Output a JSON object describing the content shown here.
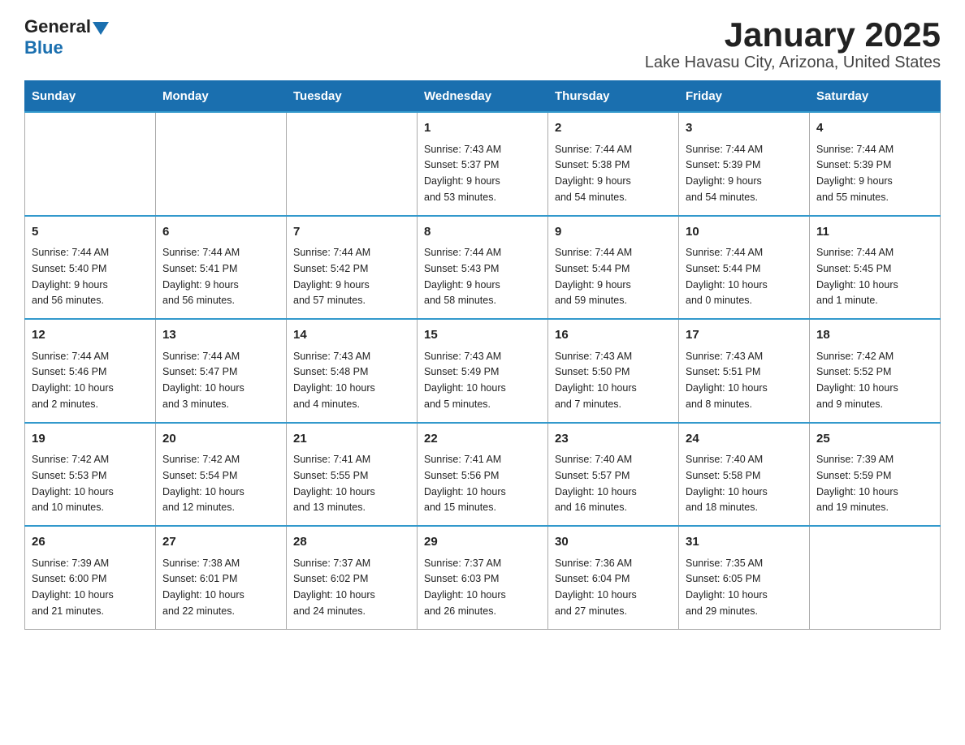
{
  "header": {
    "logo": {
      "general": "General",
      "blue": "Blue"
    },
    "title": "January 2025",
    "subtitle": "Lake Havasu City, Arizona, United States"
  },
  "days_of_week": [
    "Sunday",
    "Monday",
    "Tuesday",
    "Wednesday",
    "Thursday",
    "Friday",
    "Saturday"
  ],
  "weeks": [
    [
      {
        "day": "",
        "info": ""
      },
      {
        "day": "",
        "info": ""
      },
      {
        "day": "",
        "info": ""
      },
      {
        "day": "1",
        "info": "Sunrise: 7:43 AM\nSunset: 5:37 PM\nDaylight: 9 hours\nand 53 minutes."
      },
      {
        "day": "2",
        "info": "Sunrise: 7:44 AM\nSunset: 5:38 PM\nDaylight: 9 hours\nand 54 minutes."
      },
      {
        "day": "3",
        "info": "Sunrise: 7:44 AM\nSunset: 5:39 PM\nDaylight: 9 hours\nand 54 minutes."
      },
      {
        "day": "4",
        "info": "Sunrise: 7:44 AM\nSunset: 5:39 PM\nDaylight: 9 hours\nand 55 minutes."
      }
    ],
    [
      {
        "day": "5",
        "info": "Sunrise: 7:44 AM\nSunset: 5:40 PM\nDaylight: 9 hours\nand 56 minutes."
      },
      {
        "day": "6",
        "info": "Sunrise: 7:44 AM\nSunset: 5:41 PM\nDaylight: 9 hours\nand 56 minutes."
      },
      {
        "day": "7",
        "info": "Sunrise: 7:44 AM\nSunset: 5:42 PM\nDaylight: 9 hours\nand 57 minutes."
      },
      {
        "day": "8",
        "info": "Sunrise: 7:44 AM\nSunset: 5:43 PM\nDaylight: 9 hours\nand 58 minutes."
      },
      {
        "day": "9",
        "info": "Sunrise: 7:44 AM\nSunset: 5:44 PM\nDaylight: 9 hours\nand 59 minutes."
      },
      {
        "day": "10",
        "info": "Sunrise: 7:44 AM\nSunset: 5:44 PM\nDaylight: 10 hours\nand 0 minutes."
      },
      {
        "day": "11",
        "info": "Sunrise: 7:44 AM\nSunset: 5:45 PM\nDaylight: 10 hours\nand 1 minute."
      }
    ],
    [
      {
        "day": "12",
        "info": "Sunrise: 7:44 AM\nSunset: 5:46 PM\nDaylight: 10 hours\nand 2 minutes."
      },
      {
        "day": "13",
        "info": "Sunrise: 7:44 AM\nSunset: 5:47 PM\nDaylight: 10 hours\nand 3 minutes."
      },
      {
        "day": "14",
        "info": "Sunrise: 7:43 AM\nSunset: 5:48 PM\nDaylight: 10 hours\nand 4 minutes."
      },
      {
        "day": "15",
        "info": "Sunrise: 7:43 AM\nSunset: 5:49 PM\nDaylight: 10 hours\nand 5 minutes."
      },
      {
        "day": "16",
        "info": "Sunrise: 7:43 AM\nSunset: 5:50 PM\nDaylight: 10 hours\nand 7 minutes."
      },
      {
        "day": "17",
        "info": "Sunrise: 7:43 AM\nSunset: 5:51 PM\nDaylight: 10 hours\nand 8 minutes."
      },
      {
        "day": "18",
        "info": "Sunrise: 7:42 AM\nSunset: 5:52 PM\nDaylight: 10 hours\nand 9 minutes."
      }
    ],
    [
      {
        "day": "19",
        "info": "Sunrise: 7:42 AM\nSunset: 5:53 PM\nDaylight: 10 hours\nand 10 minutes."
      },
      {
        "day": "20",
        "info": "Sunrise: 7:42 AM\nSunset: 5:54 PM\nDaylight: 10 hours\nand 12 minutes."
      },
      {
        "day": "21",
        "info": "Sunrise: 7:41 AM\nSunset: 5:55 PM\nDaylight: 10 hours\nand 13 minutes."
      },
      {
        "day": "22",
        "info": "Sunrise: 7:41 AM\nSunset: 5:56 PM\nDaylight: 10 hours\nand 15 minutes."
      },
      {
        "day": "23",
        "info": "Sunrise: 7:40 AM\nSunset: 5:57 PM\nDaylight: 10 hours\nand 16 minutes."
      },
      {
        "day": "24",
        "info": "Sunrise: 7:40 AM\nSunset: 5:58 PM\nDaylight: 10 hours\nand 18 minutes."
      },
      {
        "day": "25",
        "info": "Sunrise: 7:39 AM\nSunset: 5:59 PM\nDaylight: 10 hours\nand 19 minutes."
      }
    ],
    [
      {
        "day": "26",
        "info": "Sunrise: 7:39 AM\nSunset: 6:00 PM\nDaylight: 10 hours\nand 21 minutes."
      },
      {
        "day": "27",
        "info": "Sunrise: 7:38 AM\nSunset: 6:01 PM\nDaylight: 10 hours\nand 22 minutes."
      },
      {
        "day": "28",
        "info": "Sunrise: 7:37 AM\nSunset: 6:02 PM\nDaylight: 10 hours\nand 24 minutes."
      },
      {
        "day": "29",
        "info": "Sunrise: 7:37 AM\nSunset: 6:03 PM\nDaylight: 10 hours\nand 26 minutes."
      },
      {
        "day": "30",
        "info": "Sunrise: 7:36 AM\nSunset: 6:04 PM\nDaylight: 10 hours\nand 27 minutes."
      },
      {
        "day": "31",
        "info": "Sunrise: 7:35 AM\nSunset: 6:05 PM\nDaylight: 10 hours\nand 29 minutes."
      },
      {
        "day": "",
        "info": ""
      }
    ]
  ]
}
